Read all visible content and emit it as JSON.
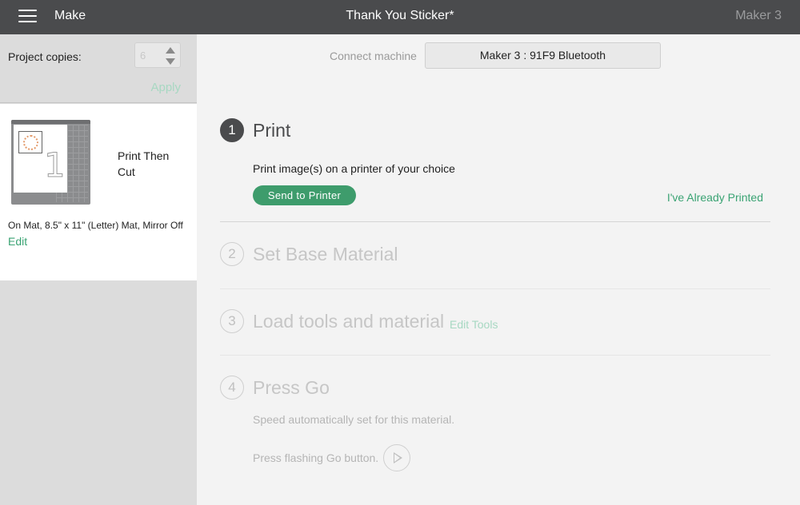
{
  "topbar": {
    "menu_icon": "hamburger-menu-icon",
    "mode": "Make",
    "project_title": "Thank You Sticker*",
    "machine": "Maker 3"
  },
  "left_panel": {
    "copies_label": "Project copies:",
    "copies_value": "6",
    "apply_label": "Apply",
    "mat": {
      "number": "1",
      "label": "Print Then Cut",
      "info": "On Mat, 8.5\" x 11\" (Letter) Mat, Mirror Off",
      "edit_label": "Edit"
    }
  },
  "connect": {
    "label": "Connect machine",
    "selected_machine": "Maker 3 : 91F9 Bluetooth"
  },
  "steps": [
    {
      "number": "1",
      "title": "Print",
      "state": "active"
    },
    {
      "number": "2",
      "title": "Set Base Material",
      "state": "inactive"
    },
    {
      "number": "3",
      "title": "Load tools and material",
      "state": "inactive"
    },
    {
      "number": "4",
      "title": "Press Go",
      "state": "inactive"
    }
  ],
  "print_step": {
    "description": "Print image(s) on a printer of your choice",
    "send_button": "Send to Printer",
    "already_printed": "I've Already Printed"
  },
  "load_step": {
    "edit_tools": "Edit Tools"
  },
  "go_step": {
    "speed_text": "Speed automatically set for this material.",
    "press_text": "Press flashing Go button.",
    "go_icon": "play-icon"
  },
  "colors": {
    "topbar": "#4a4b4d",
    "accent_green": "#3e9c6c",
    "link_green": "#3aa373",
    "disabled_green": "#a7d8c2"
  }
}
